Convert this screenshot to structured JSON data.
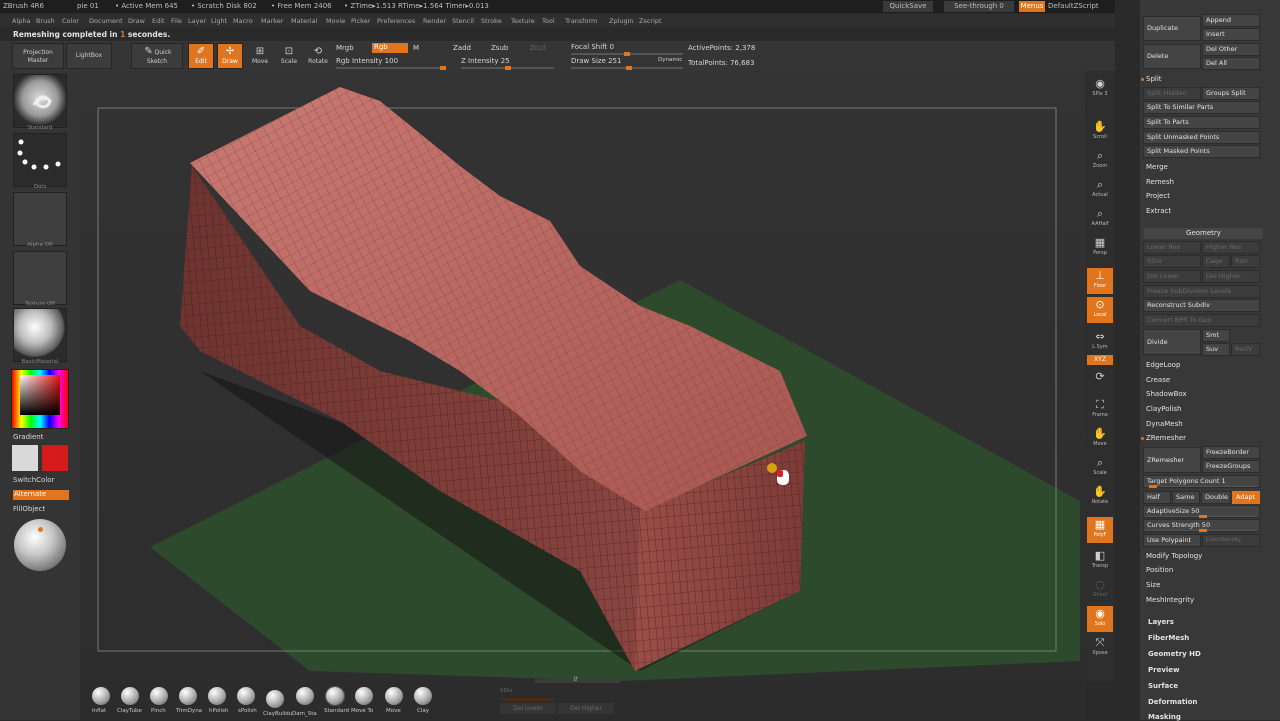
{
  "title_bar": {
    "items": [
      "ZBrush 4R6",
      "pie 01",
      "• Active Mem 645",
      "• Scratch Disk 802",
      "• Free Mem 2406",
      "• ZTime▸1.513 RTime▸1.564 Timer▸0.013"
    ],
    "quicksave": "QuickSave",
    "see_through": "See-through  0",
    "menus": "Menus",
    "default_zscript": "DefaultZScript"
  },
  "menu_bar": [
    "Alpha",
    "Brush",
    "Color",
    "Document",
    "Draw",
    "Edit",
    "File",
    "Layer",
    "Light",
    "Macro",
    "Marker",
    "Material",
    "Movie",
    "Picker",
    "Preferences",
    "Render",
    "Stencil",
    "Stroke",
    "Texture",
    "Tool",
    "Transform",
    "Zplugin",
    "Zscript"
  ],
  "status": {
    "text_a": "Remeshing completed in ",
    "text_b": "1",
    "text_c": " secondes."
  },
  "toolbar": {
    "projection_master": "Projection Master",
    "lightbox": "LightBox",
    "quick_sketch": "Quick Sketch",
    "edit": "Edit",
    "draw": "Draw",
    "move": "Move",
    "scale": "Scale",
    "rotate": "Rotate",
    "mrgb": "Mrgb",
    "rgb": "Rgb",
    "m": "M",
    "rgb_intensity": "Rgb  Intensity 100",
    "zadd": "Zadd",
    "zsub": "Zsub",
    "zcut": "Zcut",
    "z_intensity": "Z Intensity 25",
    "focal_shift": "Focal Shift 0",
    "draw_size": "Draw Size 251",
    "dynamic": "Dynamic",
    "active_points": "ActivePoints: 2,378",
    "total_points": "TotalPoints: 76,683"
  },
  "left_panel": {
    "brush_label": "Standard",
    "stroke_label": "Dots",
    "alpha_label": "Alpha  Off",
    "texture_label": "Texture  Off",
    "material_label": "BasicMaterial",
    "gradient": "Gradient",
    "switch_color": "SwitchColor",
    "alternate": "Alternate",
    "fill_object": "FillObject",
    "secondary_color": "#d41a1a",
    "primary_color": "#d9d9d9"
  },
  "right_strip": [
    {
      "label": "SPix 3",
      "icon": "bpr-icon"
    },
    {
      "label": "Scroll",
      "icon": "scroll-icon"
    },
    {
      "label": "Zoom",
      "icon": "zoom-icon"
    },
    {
      "label": "Actual",
      "icon": "actual-icon"
    },
    {
      "label": "AAHalf",
      "icon": "aahalf-icon"
    },
    {
      "label": "Persp",
      "icon": "persp-icon"
    },
    {
      "label": "Floor",
      "icon": "floor-icon"
    },
    {
      "label": "Local",
      "icon": "local-icon"
    },
    {
      "label": "L.Sym",
      "icon": "lsym-icon"
    },
    {
      "label": "XYZ",
      "icon": "xyz-icon"
    },
    {
      "label": "Frame",
      "icon": "frame-icon"
    },
    {
      "label": "Move",
      "icon": "move-icon"
    },
    {
      "label": "Scale",
      "icon": "scale-icon"
    },
    {
      "label": "Rotate",
      "icon": "rotate-icon"
    },
    {
      "label": "PolyF",
      "icon": "polyf-icon"
    },
    {
      "label": "Transp",
      "icon": "transp-icon"
    },
    {
      "label": "Ghost",
      "icon": "ghost-icon"
    },
    {
      "label": "Solo",
      "icon": "solo-icon"
    },
    {
      "label": "Xpose",
      "icon": "xpose-icon"
    }
  ],
  "right_panel": {
    "duplicate": "Duplicate",
    "append": "Append",
    "insert": "Insert",
    "delete": "Delete",
    "del_other": "Del Other",
    "del_all": "Del All",
    "split": "Split",
    "split_hidden": "Split Hidden",
    "groups_split": "Groups Split",
    "split_similar": "Split To Similar Parts",
    "split_parts": "Split To Parts",
    "split_unmasked": "Split Unmasked Points",
    "split_masked": "Split Masked Points",
    "merge": "Merge",
    "remesh": "Remesh",
    "project": "Project",
    "extract": "Extract",
    "geometry": "Geometry",
    "lower_res": "Lower Res",
    "higher_res": "Higher Res",
    "sdiv": "SDiv",
    "cage": "Cage",
    "rstr": "Rstr",
    "del_lower": "Del Lower",
    "del_higher": "Del Higher",
    "freeze_subdiv": "Freeze SubDivision Levels",
    "reconstruct_subdiv": "Reconstruct Subdiv",
    "convert_bpr": "Convert BPR To Geo",
    "divide": "Divide",
    "smt": "Smt",
    "suv": "Suv",
    "reuv": "ReUV",
    "edgeloop": "EdgeLoop",
    "crease": "Crease",
    "shadowbox": "ShadowBox",
    "claypolish": "ClayPolish",
    "dynamesh": "DynaMesh",
    "zremesher_hdr": "ZRemesher",
    "zremesher_btn": "ZRemesher",
    "freeze_border": "FreezeBorder",
    "freeze_groups": "FreezeGroups",
    "target_polygons": "Target Polygons Count 1",
    "half": "Half",
    "same": "Same",
    "double": "Double",
    "adapt": "Adapt",
    "adaptive_size": "AdaptiveSize 50",
    "curves_strength": "Curves Strength 50",
    "use_polypaint": "Use Polypaint",
    "color_density": "ColorDensity",
    "modify_topology": "Modify Topology",
    "position": "Position",
    "size": "Size",
    "mesh_integrity": "MeshIntegrity",
    "layers": "Layers",
    "fibermesh": "FiberMesh",
    "geometry_hd": "Geometry HD",
    "preview": "Preview",
    "surface": "Surface",
    "deformation": "Deformation",
    "masking": "Masking"
  },
  "bottom_shelf": {
    "brushes": [
      "Inflat",
      "ClayTube",
      "Pinch",
      "TrimDyna",
      "hPolish",
      "sPolish",
      "ClayBuildu",
      "Dam_Sta",
      "Standard",
      "Move To",
      "Move",
      "Clay"
    ],
    "sdiv": "SDiv",
    "del_lower": "Del Lower",
    "del_higher": "Del Higher"
  },
  "colors": {
    "accent": "#e0751d",
    "mesh": "#b5605a",
    "floor": "#2e4a2c"
  }
}
